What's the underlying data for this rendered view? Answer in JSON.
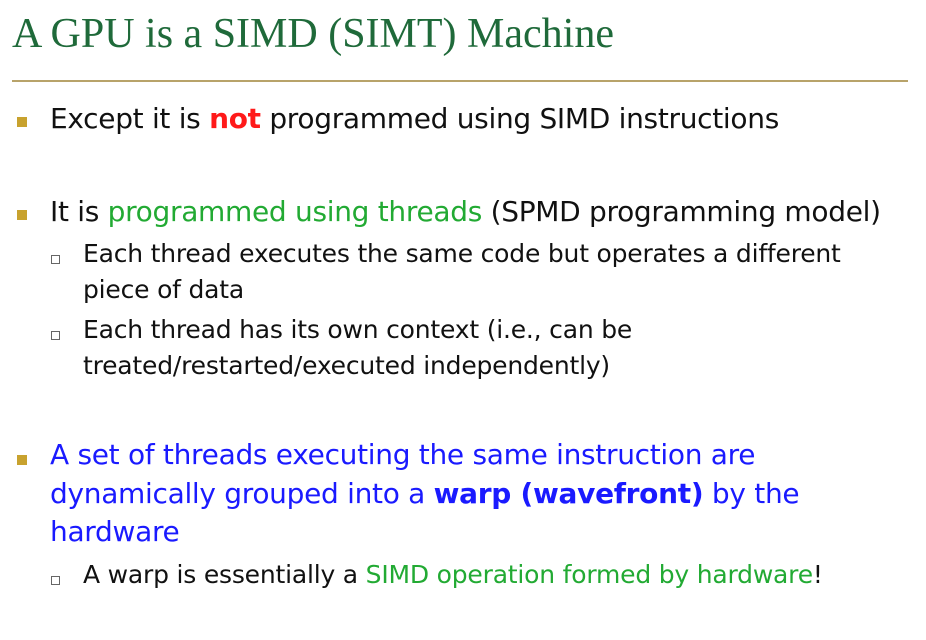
{
  "title": "A GPU is a SIMD (SIMT) Machine",
  "b1": {
    "pre": "Except it is ",
    "emph": "not",
    "post": " programmed using SIMD instructions"
  },
  "b2": {
    "pre": "It is ",
    "green": "programmed using threads",
    "post": " (SPMD programming model)",
    "sub1": {
      "line1": "Each thread executes the same code but operates a different",
      "line2": "piece of data"
    },
    "sub2": {
      "line1": "Each thread has its own context (i.e., can be",
      "line2": "treated/restarted/executed  independently)"
    }
  },
  "b3": {
    "line1": "A set of threads executing the same instruction are",
    "line2_pre": "dynamically grouped into a ",
    "line2_bold": "warp (wavefront)",
    "line2_post": " by the",
    "line3": "hardware",
    "sub1": {
      "pre": "A warp is essentially a ",
      "green": "SIMD operation formed by hardware",
      "post": "!"
    }
  },
  "colors": {
    "title": "#1f6a3a",
    "bullet": "#c8a22e",
    "emphasis_red": "#ff1a1a",
    "emphasis_green": "#22aa33",
    "emphasis_blue": "#1a1aff"
  }
}
